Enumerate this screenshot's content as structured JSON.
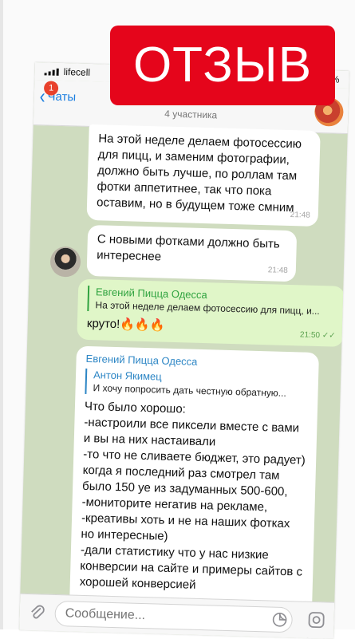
{
  "status_bar": {
    "carrier": "lifecell",
    "battery_percent": "%"
  },
  "header": {
    "back_label": "Чаты",
    "unread_badge": "1",
    "subtitle": "4 участника"
  },
  "messages": [
    {
      "id": "m1",
      "direction": "in",
      "text": "На этой неделе делаем фотосессию для пицц, и заменим фотографии, должно быть лучше, по роллам там фотки аппетитнее, так что пока оставим, но в будущем тоже смним",
      "time": "21:48"
    },
    {
      "id": "m2",
      "direction": "in",
      "text": "С новыми фотками должно быть интереснее",
      "time": "21:48"
    },
    {
      "id": "m3",
      "direction": "out",
      "forward_name": "Евгений Пицца Одесса",
      "forward_text": "На этой неделе делаем фотосессию для пицц, и...",
      "text": "круто!🔥🔥🔥",
      "time": "21:50"
    },
    {
      "id": "m4",
      "direction": "in",
      "sender": "Евгений Пицца Одесса",
      "reply_name": "Антон Якимец",
      "reply_text": "И хочу попросить дать честную обратную...",
      "text": "Что было хорошо:\n-настроили все пиксели вместе с вами и вы на них настаивали\n-то что не сливаете бюджет, это радует) когда я последний раз смотрел там было 150 уе из задуманных 500-600,\n-мониторите негатив на рекламе,\n-креативы хоть и не на наших фотках но интересные)\n-дали статистику что у нас низкие конверсии на сайте и примеры сайтов с хорошей конверсией"
    }
  ],
  "input": {
    "placeholder": "Сообщение..."
  },
  "banner": {
    "text": "ОТЗЫВ"
  },
  "colors": {
    "banner_red": "#e5051b",
    "chat_background": "#cfdcbf",
    "outgoing_bubble": "#e0f6c8",
    "link_blue": "#1a7ee0",
    "forward_green": "#2fa33f"
  },
  "icons": {
    "back": "chevron-left-icon",
    "attach": "paperclip-icon",
    "sticker": "sticker-icon",
    "camera": "camera-icon",
    "scroll_down": "chevron-down-icon"
  }
}
